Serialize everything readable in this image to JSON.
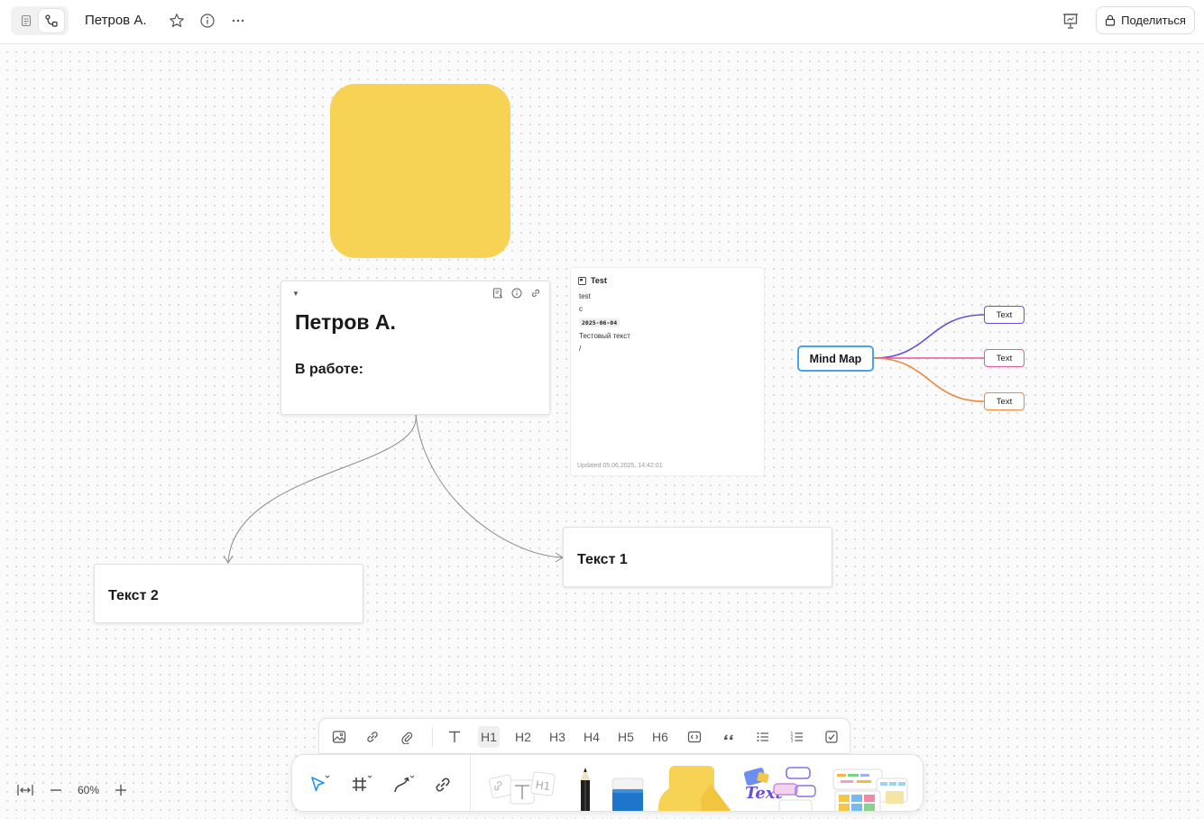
{
  "header": {
    "doc_title": "Петров А.",
    "share_label": "Поделиться"
  },
  "canvas": {
    "main_note": {
      "heading": "Петров А.",
      "subheading": "В работе:"
    },
    "note_text1": "Текст 1",
    "note_text2": "Текст 2",
    "embed": {
      "title": "Test",
      "lines": [
        "test",
        "c",
        "Тестовый текст",
        "/"
      ],
      "date_tag": "2025-06-04",
      "updated": "Updated  05.06.2025, 14:42:01"
    },
    "mindmap": {
      "root": "Mind Map",
      "children": [
        {
          "label": "Text",
          "color": "#6a4fd8"
        },
        {
          "label": "Text",
          "color": "#e05aa0"
        },
        {
          "label": "Text",
          "color": "#f0883a"
        }
      ]
    },
    "shape_color": "#f6d255"
  },
  "text_toolbar": {
    "headings": [
      "H1",
      "H2",
      "H3",
      "H4",
      "H5",
      "H6"
    ],
    "active": "H1"
  },
  "zoom": {
    "value": "60%"
  }
}
